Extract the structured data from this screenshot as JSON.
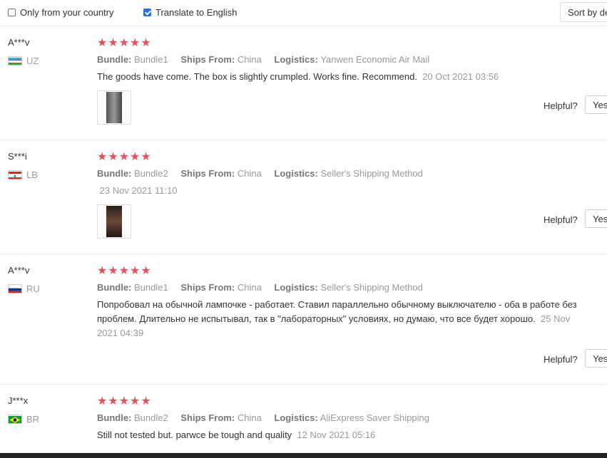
{
  "filters": {
    "only_country": {
      "label": "Only from your country",
      "checked": false
    },
    "translate": {
      "label": "Translate to English",
      "checked": true
    },
    "sort_label": "Sort by de"
  },
  "labels": {
    "bundle": "Bundle:",
    "ships_from": "Ships From:",
    "logistics": "Logistics:",
    "helpful": "Helpful?",
    "yes": "Yes",
    "stars": "★★★★★"
  },
  "reviews": [
    {
      "user": "A***v",
      "country": "UZ",
      "bundle": "Bundle1",
      "ships_from": "China",
      "logistics": "Yanwen Economic Air Mail",
      "text": "The goods have come. The box is slightly crumpled. Works fine. Recommend.",
      "date": "20 Oct 2021 03:56",
      "rating": 5
    },
    {
      "user": "S***i",
      "country": "LB",
      "bundle": "Bundle2",
      "ships_from": "China",
      "logistics": "Seller's Shipping Method",
      "text": "",
      "date": "23 Nov 2021 11:10",
      "rating": 5
    },
    {
      "user": "A***v",
      "country": "RU",
      "bundle": "Bundle1",
      "ships_from": "China",
      "logistics": "Seller's Shipping Method",
      "text_line1": "Попробовал на обычной лампочке - работает. Ставил параллельно обычному выключателю - оба в работе без",
      "text_line2": "проблем. Длительно не испытывал, так в \"лабораторных\" условиях, но думаю, что все будет хорошо.",
      "date_part1": "25 Nov",
      "date_part2": "2021 04:39",
      "rating": 5
    },
    {
      "user": "J***x",
      "country": "BR",
      "bundle": "Bundle2",
      "ships_from": "China",
      "logistics": "AliExpress Saver Shipping",
      "text": "Still not tested but. parwce be tough and quality",
      "date": "12 Nov 2021 05:16",
      "rating": 5
    }
  ]
}
